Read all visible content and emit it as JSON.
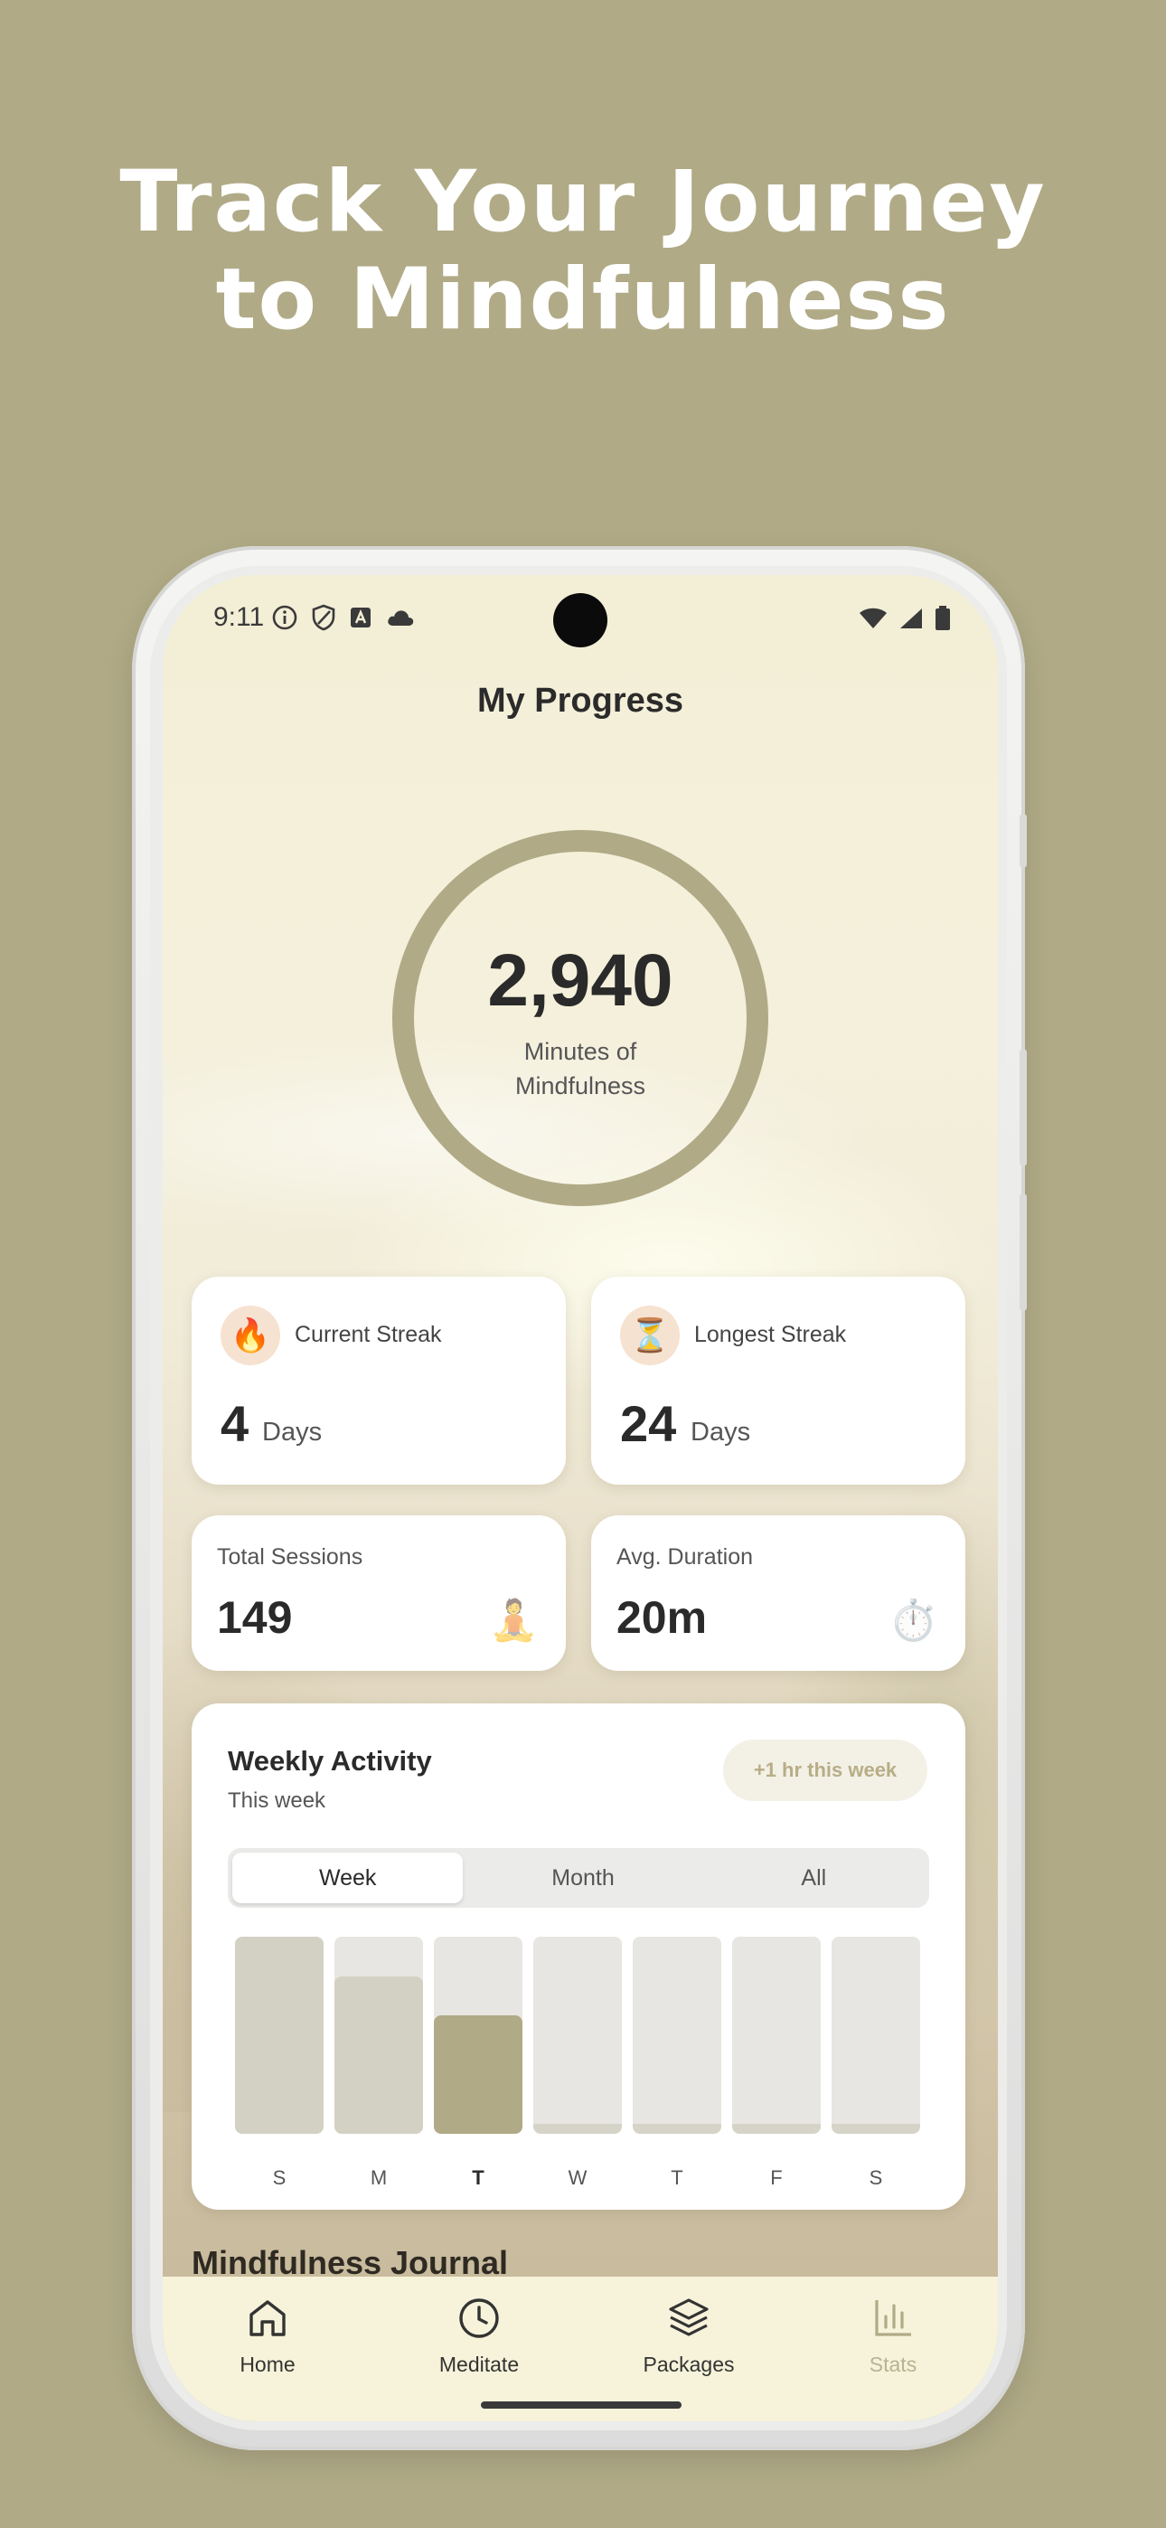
{
  "headline": {
    "line1": "Track Your Journey",
    "line2": "to Mindfulness"
  },
  "status_bar": {
    "time": "9:11",
    "left_icons": [
      "info-icon",
      "shield-icon",
      "a-icon",
      "cloud-icon"
    ],
    "right_icons": [
      "wifi-icon",
      "signal-icon",
      "battery-icon"
    ]
  },
  "page": {
    "title": "My Progress"
  },
  "ring": {
    "value": "2,940",
    "label": "Minutes of Mindfulness",
    "color": "#b0aa86"
  },
  "streaks": [
    {
      "label": "Current Streak",
      "value": "4",
      "unit": "Days",
      "icon": "fire-icon"
    },
    {
      "label": "Longest Streak",
      "value": "24",
      "unit": "Days",
      "icon": "hourglass-icon"
    }
  ],
  "stats": [
    {
      "label": "Total Sessions",
      "value": "149",
      "icon": "meditation-icon"
    },
    {
      "label": "Avg. Duration",
      "value": "20m",
      "icon": "stopwatch-icon"
    }
  ],
  "weekly": {
    "title": "Weekly Activity",
    "subtitle": "This week",
    "badge": "+1 hr this week",
    "tabs": [
      "Week",
      "Month",
      "All"
    ],
    "active_tab": "Week",
    "days": [
      "S",
      "M",
      "T",
      "W",
      "T",
      "F",
      "S"
    ],
    "fill_fractions": [
      1.0,
      0.8,
      0.6,
      0.05,
      0.05,
      0.05,
      0.05
    ],
    "today_index": 2,
    "colors": {
      "past": "#d3d1c3",
      "today": "#b0aa86",
      "empty": "#d6d4c8",
      "track": "#e7e6e2"
    }
  },
  "journal": {
    "title": "Mindfulness Journal"
  },
  "tab_bar": {
    "items": [
      {
        "label": "Home",
        "icon": "home-icon",
        "active": true
      },
      {
        "label": "Meditate",
        "icon": "clock-icon",
        "active": true
      },
      {
        "label": "Packages",
        "icon": "layers-icon",
        "active": true
      },
      {
        "label": "Stats",
        "icon": "bar-chart-icon",
        "active": false
      }
    ]
  },
  "colors": {
    "background": "#b0aa86",
    "accent": "#b0aa86",
    "tab_bar": "#f6f3da"
  }
}
